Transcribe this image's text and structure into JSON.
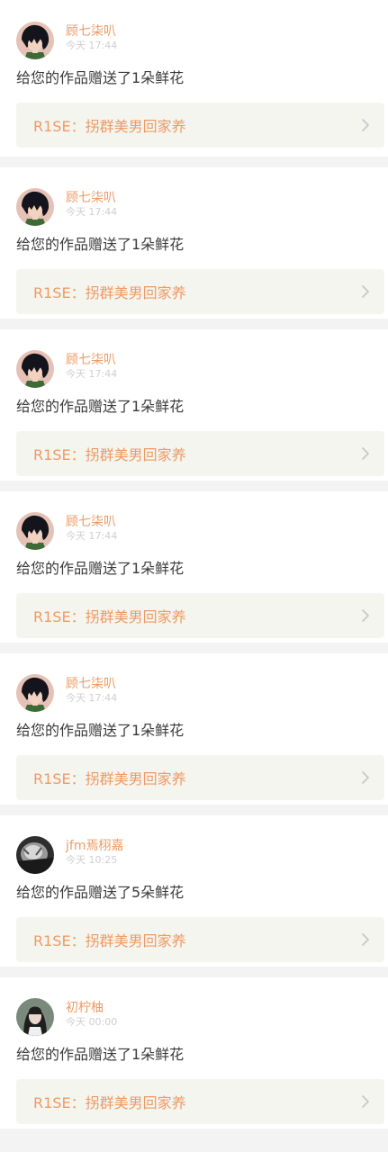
{
  "colors": {
    "accent": "#ee9b64",
    "link_bg": "#f5f5ef",
    "tab_indicator": "#e56b85"
  },
  "notifications": [
    {
      "avatar_icon": "anime-avatar-icon",
      "username": "顾七柒叭",
      "time": "今天 17:44",
      "message": "给您的作品赠送了1朵鲜花",
      "work_title": "R1SE：拐群美男回家养"
    },
    {
      "avatar_icon": "anime-avatar-icon",
      "username": "顾七柒叭",
      "time": "今天 17:44",
      "message": "给您的作品赠送了1朵鲜花",
      "work_title": "R1SE：拐群美男回家养"
    },
    {
      "avatar_icon": "anime-avatar-icon",
      "username": "顾七柒叭",
      "time": "今天 17:44",
      "message": "给您的作品赠送了1朵鲜花",
      "work_title": "R1SE：拐群美男回家养"
    },
    {
      "avatar_icon": "anime-avatar-icon",
      "username": "顾七柒叭",
      "time": "今天 17:44",
      "message": "给您的作品赠送了1朵鲜花",
      "work_title": "R1SE：拐群美男回家养"
    },
    {
      "avatar_icon": "anime-avatar-icon",
      "username": "顾七柒叭",
      "time": "今天 17:44",
      "message": "给您的作品赠送了1朵鲜花",
      "work_title": "R1SE：拐群美男回家养"
    },
    {
      "avatar_icon": "photo-avatar-icon",
      "username": "jfm焉栩嘉",
      "time": "今天 10:25",
      "message": "给您的作品赠送了5朵鲜花",
      "work_title": "R1SE：拐群美男回家养"
    },
    {
      "avatar_icon": "portrait-avatar-icon",
      "username": "初柠柚",
      "time": "今天 00:00",
      "message": "给您的作品赠送了1朵鲜花",
      "work_title": "R1SE：拐群美男回家养"
    }
  ]
}
